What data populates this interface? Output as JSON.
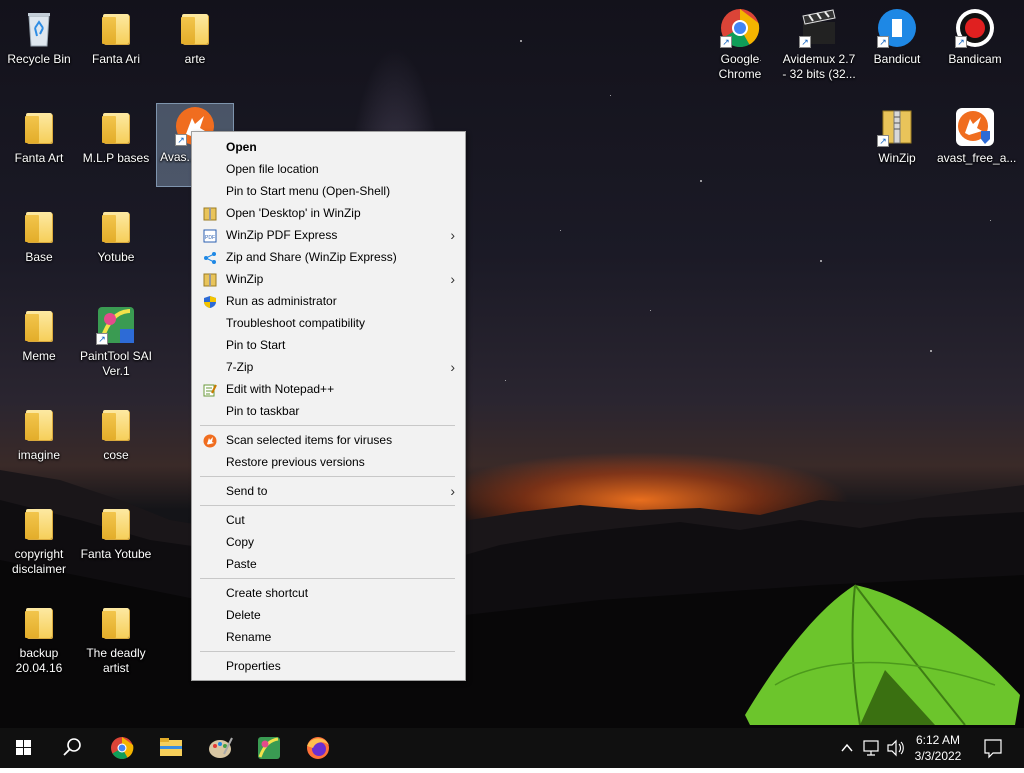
{
  "desktop": {
    "icons": [
      {
        "label": "Recycle Bin",
        "kind": "recycle-bin"
      },
      {
        "label": "Fanta Ari",
        "kind": "folder"
      },
      {
        "label": "arte",
        "kind": "folder"
      },
      {
        "label": "Fanta Art",
        "kind": "folder"
      },
      {
        "label": "M.L.P bases",
        "kind": "folder"
      },
      {
        "label": "Avas... Anti...",
        "kind": "avast"
      },
      {
        "label": "Base",
        "kind": "folder"
      },
      {
        "label": "Yotube",
        "kind": "folder"
      },
      {
        "label": "Meme",
        "kind": "folder"
      },
      {
        "label": "PaintTool SAI Ver.1",
        "kind": "painttool"
      },
      {
        "label": "imagine",
        "kind": "folder"
      },
      {
        "label": "cose",
        "kind": "folder"
      },
      {
        "label": "copyright disclaimer",
        "kind": "folder"
      },
      {
        "label": "Fanta Yotube",
        "kind": "folder"
      },
      {
        "label": "backup 20.04.16",
        "kind": "folder"
      },
      {
        "label": "The deadly artist",
        "kind": "folder"
      },
      {
        "label": "Google Chrome",
        "kind": "chrome"
      },
      {
        "label": "Avidemux 2.7 - 32 bits (32...",
        "kind": "avidemux"
      },
      {
        "label": "Bandicut",
        "kind": "bandicut"
      },
      {
        "label": "Bandicam",
        "kind": "bandicam"
      },
      {
        "label": "WinZip",
        "kind": "winzip"
      },
      {
        "label": "avast_free_a...",
        "kind": "avast"
      }
    ]
  },
  "context_menu": {
    "sections": [
      [
        {
          "label": "Open",
          "bold": true
        },
        {
          "label": "Open file location"
        },
        {
          "label": "Pin to Start menu (Open-Shell)"
        },
        {
          "label": "Open 'Desktop' in WinZip",
          "icon": "winzip-icon"
        },
        {
          "label": "WinZip PDF Express",
          "icon": "pdf-icon",
          "submenu": true
        },
        {
          "label": "Zip and Share (WinZip Express)",
          "icon": "share-icon"
        },
        {
          "label": "WinZip",
          "icon": "winzip-icon",
          "submenu": true
        },
        {
          "label": "Run as administrator",
          "icon": "uac-shield-icon"
        },
        {
          "label": "Troubleshoot compatibility"
        },
        {
          "label": "Pin to Start"
        },
        {
          "label": "7-Zip",
          "submenu": true
        },
        {
          "label": "Edit with Notepad++",
          "icon": "notepad-icon"
        },
        {
          "label": "Pin to taskbar"
        }
      ],
      [
        {
          "label": "Scan selected items for viruses",
          "icon": "avast-icon"
        },
        {
          "label": "Restore previous versions"
        }
      ],
      [
        {
          "label": "Send to",
          "submenu": true
        }
      ],
      [
        {
          "label": "Cut"
        },
        {
          "label": "Copy"
        },
        {
          "label": "Paste"
        }
      ],
      [
        {
          "label": "Create shortcut"
        },
        {
          "label": "Delete"
        },
        {
          "label": "Rename"
        }
      ],
      [
        {
          "label": "Properties"
        }
      ]
    ],
    "submenu_glyph": "›"
  },
  "taskbar": {
    "pinned": [
      "windows-start-icon",
      "search-icon",
      "chrome-icon",
      "file-explorer-icon",
      "paint-palette-icon",
      "painttool-sai-icon",
      "firefox-icon"
    ],
    "tray": {
      "time": "6:12 AM",
      "date": "3/3/2022",
      "icons": [
        "chevron-up-icon",
        "network-icon",
        "volume-icon",
        "notification-icon"
      ]
    }
  },
  "colors": {
    "menu_bg": "#f2f2f2",
    "taskbar_bg": "#101010",
    "folder": "#f6cf5a",
    "avast_orange": "#f06d1f",
    "tent_green": "#7fd33a"
  }
}
